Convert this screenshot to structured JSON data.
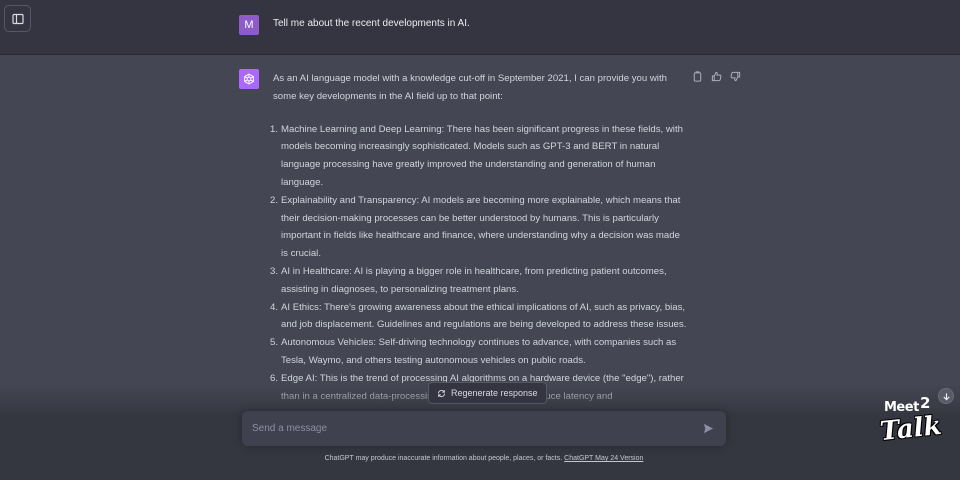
{
  "user_message": {
    "avatar_letter": "M",
    "text": "Tell me about the recent developments in AI."
  },
  "assistant_message": {
    "intro": "As an AI language model with a knowledge cut-off in September 2021, I can provide you with some key developments in the AI field up to that point:",
    "items": [
      {
        "num": "1.",
        "text": "Machine Learning and Deep Learning: There has been significant progress in these fields, with models becoming increasingly sophisticated. Models such as GPT-3 and BERT in natural language processing have greatly improved the understanding and generation of human language."
      },
      {
        "num": "2.",
        "text": "Explainability and Transparency: AI models are becoming more explainable, which means that their decision-making processes can be better understood by humans. This is particularly important in fields like healthcare and finance, where understanding why a decision was made is crucial."
      },
      {
        "num": "3.",
        "text": "AI in Healthcare: AI is playing a bigger role in healthcare, from predicting patient outcomes, assisting in diagnoses, to personalizing treatment plans."
      },
      {
        "num": "4.",
        "text": "AI Ethics: There's growing awareness about the ethical implications of AI, such as privacy, bias, and job displacement. Guidelines and regulations are being developed to address these issues."
      },
      {
        "num": "5.",
        "text": "Autonomous Vehicles: Self-driving technology continues to advance, with companies such as Tesla, Waymo, and others testing autonomous vehicles on public roads."
      },
      {
        "num": "6.",
        "text": "Edge AI: This is the trend of processing AI algorithms on a hardware device (the \"edge\"), rather than in a centralized data-processing warehouse. This can reduce latency and"
      }
    ]
  },
  "regenerate_label": "Regenerate response",
  "input": {
    "placeholder": "Send a message",
    "value": ""
  },
  "footer": {
    "disclaimer": "ChatGPT may produce inaccurate information about people, places, or facts.",
    "version_link": "ChatGPT May 24 Version"
  },
  "watermark": {
    "meet": "Meet",
    "two": "2",
    "talk": "Talk"
  },
  "colors": {
    "user_bg": "#343541",
    "assistant_bg": "#444654",
    "user_avatar": "#8e5cc9",
    "assistant_avatar": "#ab68ff"
  },
  "icons": [
    "sidebar-toggle-icon",
    "openai-logo-icon",
    "copy-icon",
    "thumbs-up-icon",
    "thumbs-down-icon",
    "regenerate-icon",
    "send-icon",
    "arrow-down-icon"
  ]
}
